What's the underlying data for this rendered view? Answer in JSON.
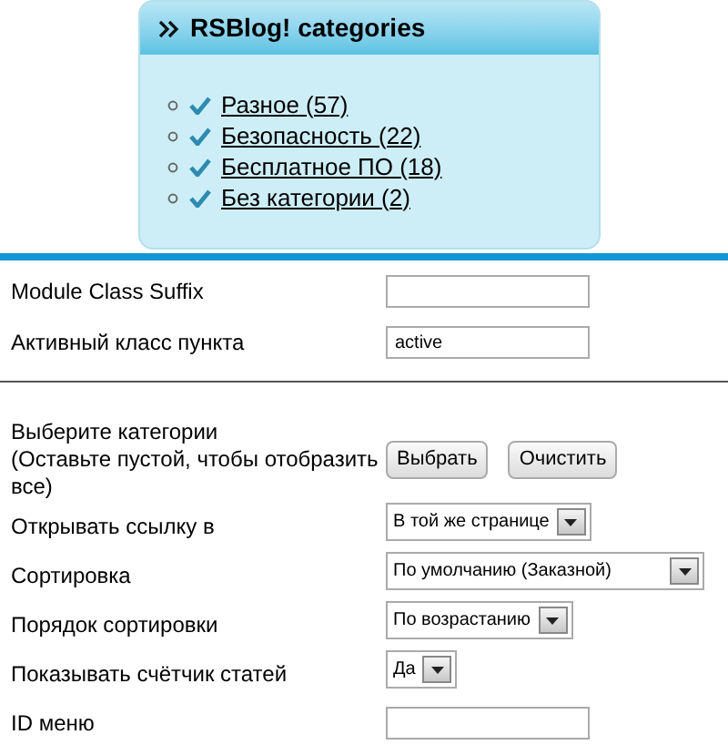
{
  "module": {
    "title": "RSBlog! categories",
    "items": [
      {
        "label": "Разное (57)"
      },
      {
        "label": "Безопасность (22)"
      },
      {
        "label": "Бесплатное ПО (18)"
      },
      {
        "label": "Без категории (2)"
      }
    ]
  },
  "form_top": [
    {
      "kind": "text",
      "label": "Module Class Suffix"
    },
    {
      "kind": "text",
      "label": "Активный класс пункта",
      "value": "active"
    }
  ],
  "form_bottom": [
    {
      "kind": "buttons",
      "label": "Выберите категории\n(Оставьте пустой, чтобы отобразить все)",
      "buttons": [
        "Выбрать",
        "Очистить"
      ]
    },
    {
      "kind": "select",
      "label": "Открывать ссылку в",
      "value": "В той же странице"
    },
    {
      "kind": "select",
      "label": "Сортировка",
      "value": "По умолчанию (Заказной)"
    },
    {
      "kind": "select",
      "label": "Порядок сортировки",
      "value": "По возрастанию"
    },
    {
      "kind": "select",
      "label": "Показывать счётчик статей",
      "value": "Да"
    },
    {
      "kind": "text",
      "label": "ID меню"
    }
  ]
}
